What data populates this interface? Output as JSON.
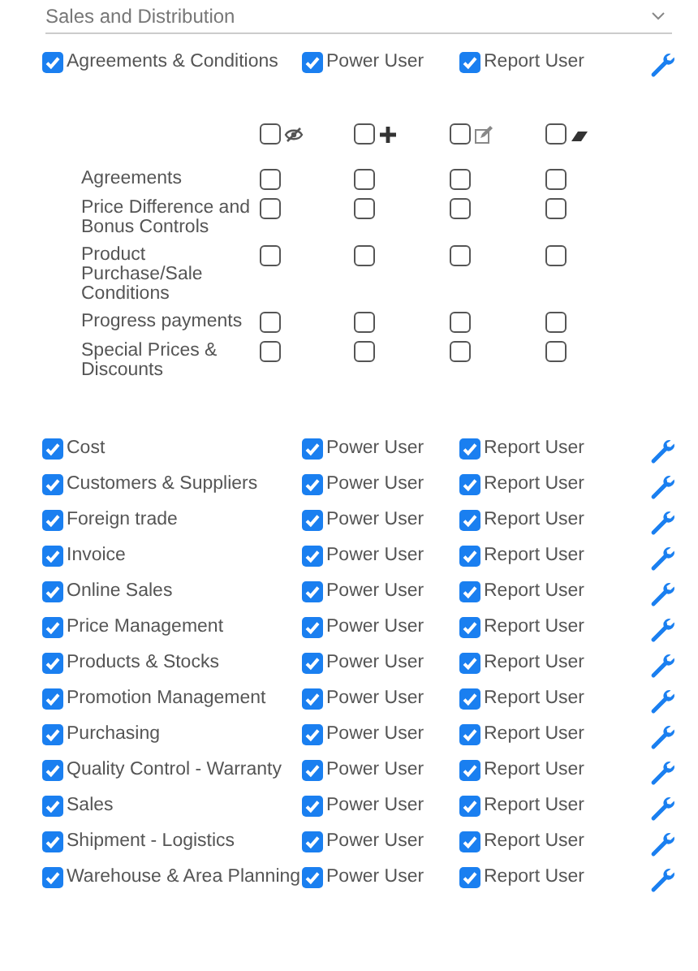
{
  "dropdown": {
    "value": "Sales and Distribution"
  },
  "expanded_module": {
    "name": "Agreements & Conditions",
    "checked": true,
    "power_user": {
      "label": "Power User",
      "checked": true
    },
    "report_user": {
      "label": "Report User",
      "checked": true
    }
  },
  "sub_permissions": {
    "columns": [
      {
        "kind": "view",
        "checked": false
      },
      {
        "kind": "add",
        "checked": false
      },
      {
        "kind": "edit",
        "checked": false
      },
      {
        "kind": "delete",
        "checked": false
      }
    ],
    "rows": [
      {
        "label": "Agreements",
        "checks": [
          false,
          false,
          false,
          false
        ]
      },
      {
        "label": "Price Difference and Bonus Controls",
        "checks": [
          false,
          false,
          false,
          false
        ]
      },
      {
        "label": "Product Purchase/Sale Conditions",
        "checks": [
          false,
          false,
          false,
          false
        ]
      },
      {
        "label": "Progress payments",
        "checks": [
          false,
          false,
          false,
          false
        ]
      },
      {
        "label": "Special Prices & Discounts",
        "checks": [
          false,
          false,
          false,
          false
        ]
      }
    ]
  },
  "modules": [
    {
      "name": "Cost",
      "checked": true,
      "power_user": {
        "label": "Power User",
        "checked": true
      },
      "report_user": {
        "label": "Report User",
        "checked": true
      }
    },
    {
      "name": "Customers & Suppliers",
      "checked": true,
      "power_user": {
        "label": "Power User",
        "checked": true
      },
      "report_user": {
        "label": "Report User",
        "checked": true
      }
    },
    {
      "name": "Foreign trade",
      "checked": true,
      "power_user": {
        "label": "Power User",
        "checked": true
      },
      "report_user": {
        "label": "Report User",
        "checked": true
      }
    },
    {
      "name": "Invoice",
      "checked": true,
      "power_user": {
        "label": "Power User",
        "checked": true
      },
      "report_user": {
        "label": "Report User",
        "checked": true
      }
    },
    {
      "name": "Online Sales",
      "checked": true,
      "power_user": {
        "label": "Power User",
        "checked": true
      },
      "report_user": {
        "label": "Report User",
        "checked": true
      }
    },
    {
      "name": "Price Management",
      "checked": true,
      "power_user": {
        "label": "Power User",
        "checked": true
      },
      "report_user": {
        "label": "Report User",
        "checked": true
      }
    },
    {
      "name": "Products & Stocks",
      "checked": true,
      "power_user": {
        "label": "Power User",
        "checked": true
      },
      "report_user": {
        "label": "Report User",
        "checked": true
      }
    },
    {
      "name": "Promotion Management",
      "checked": true,
      "power_user": {
        "label": "Power User",
        "checked": true
      },
      "report_user": {
        "label": "Report User",
        "checked": true
      }
    },
    {
      "name": "Purchasing",
      "checked": true,
      "power_user": {
        "label": "Power User",
        "checked": true
      },
      "report_user": {
        "label": "Report User",
        "checked": true
      }
    },
    {
      "name": "Quality Control - Warranty",
      "checked": true,
      "power_user": {
        "label": "Power User",
        "checked": true
      },
      "report_user": {
        "label": "Report User",
        "checked": true
      }
    },
    {
      "name": "Sales",
      "checked": true,
      "power_user": {
        "label": "Power User",
        "checked": true
      },
      "report_user": {
        "label": "Report User",
        "checked": true
      }
    },
    {
      "name": "Shipment - Logistics",
      "checked": true,
      "power_user": {
        "label": "Power User",
        "checked": true
      },
      "report_user": {
        "label": "Report User",
        "checked": true
      }
    },
    {
      "name": "Warehouse & Area Planning",
      "checked": true,
      "power_user": {
        "label": "Power User",
        "checked": true
      },
      "report_user": {
        "label": "Report User",
        "checked": true
      }
    }
  ]
}
